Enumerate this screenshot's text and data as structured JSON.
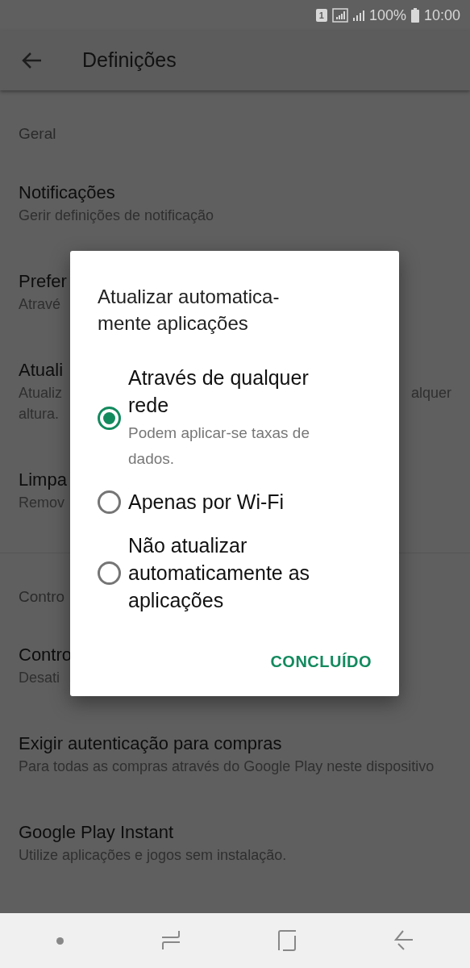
{
  "status_bar": {
    "sim": "1",
    "battery": "100%",
    "time": "10:00"
  },
  "header": {
    "title": "Definições"
  },
  "settings": [
    {
      "kind": "section",
      "title": "Geral"
    },
    {
      "kind": "item",
      "title": "Notificações",
      "subtitle": [
        "Gerir definições de notificação"
      ]
    },
    {
      "kind": "item",
      "title": "Prefer",
      "subtitle": [
        "Atravé"
      ]
    },
    {
      "kind": "item",
      "title": "Atuali",
      "subtitle": [
        "Atualiz",
        "altura."
      ],
      "subtitle_right": "alquer"
    },
    {
      "kind": "item",
      "title": "Limpa",
      "subtitle": [
        "Remov"
      ]
    },
    {
      "kind": "section",
      "title": "Contro"
    },
    {
      "kind": "item",
      "title": "Contro",
      "subtitle": [
        "Desati"
      ]
    },
    {
      "kind": "item",
      "title": "Exigir autenticação para compras",
      "subtitle": [
        "Para todas as compras através do Google Play neste dispositivo"
      ]
    },
    {
      "kind": "item",
      "title": "Google Play Instant",
      "subtitle": [
        "Utilize aplicações e jogos sem instalação."
      ]
    }
  ],
  "dialog": {
    "title": [
      "Atualizar automatica-",
      "mente aplicações"
    ],
    "options": [
      {
        "label": "Através de qualquer rede",
        "note": "Podem aplicar-se taxas de dados.",
        "selected": true
      },
      {
        "label": "Apenas por Wi-Fi",
        "selected": false
      },
      {
        "label": "Não atualizar automaticamente as aplicações",
        "selected": false
      }
    ],
    "button": "CONCLUÍDO"
  }
}
